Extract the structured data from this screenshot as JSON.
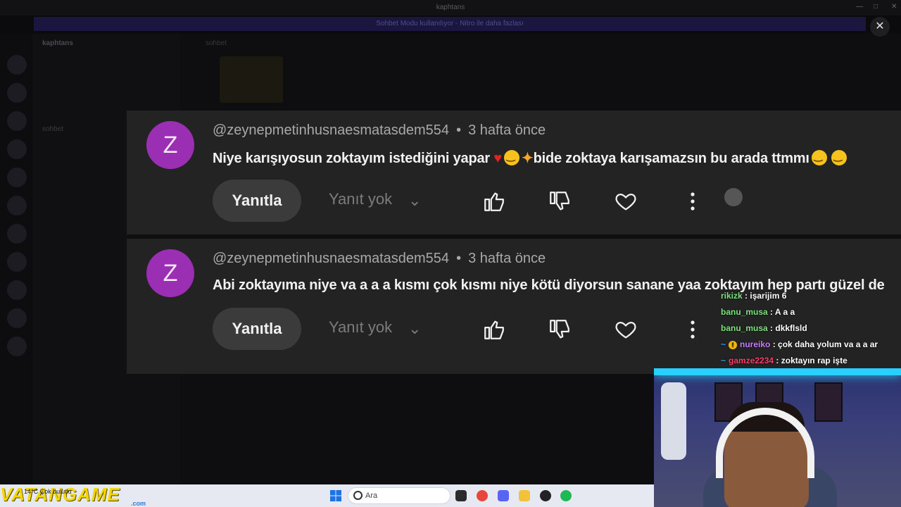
{
  "window_title": "kaphtans",
  "banner_text": "Sohbet Modu kullanılıyor - Nitro ile daha fazlası",
  "server_name": "kaphtans",
  "channel_name": "sohbet",
  "close_icon": "close-icon",
  "comments": [
    {
      "avatar_letter": "Z",
      "avatar_color": "#9b2fb4",
      "author": "@zeynepmetinhusnaesmatasdem554",
      "separator": "•",
      "time": "3 hafta önce",
      "text_a": "Niye karışıyosun zoktayım istediğini yapar",
      "text_b": "bide zoktaya karışamazsın bu arada ttmmı",
      "reply_label": "Yanıtla",
      "no_reply_label": "Yanıt yok"
    },
    {
      "avatar_letter": "Z",
      "avatar_color": "#9b2fb4",
      "author": "@zeynepmetinhusnaesmatasdem554",
      "separator": "•",
      "time": "3 hafta önce",
      "text": "Abi zoktayıma niye va a a a kısmı çok kısmı niye kötü diyorsun sanane yaa zoktayım hep partı güzel de",
      "reply_label": "Yanıtla",
      "no_reply_label": "Yanıt yok"
    }
  ],
  "chat": [
    {
      "user": "rikizk",
      "msg": ": işarijim 6"
    },
    {
      "user": "banu_musa",
      "msg": ": A a a"
    },
    {
      "user": "banu_musa",
      "msg": ": dkkflsld"
    },
    {
      "user": "nureiko",
      "msg": ": çok daha yolum va a a ar"
    },
    {
      "user": "gamze2234",
      "msg": ": zoktayın rap işte"
    }
  ],
  "taskbar": {
    "logo": "VATANGAME",
    "logo_sub": ".com",
    "weather": "14°C Çok bulutlu",
    "search_placeholder": "Ara"
  },
  "colors": {
    "comment_bg": "#232323",
    "accent_cyan": "#29d0ff",
    "chat_user": "#7fe07f"
  }
}
